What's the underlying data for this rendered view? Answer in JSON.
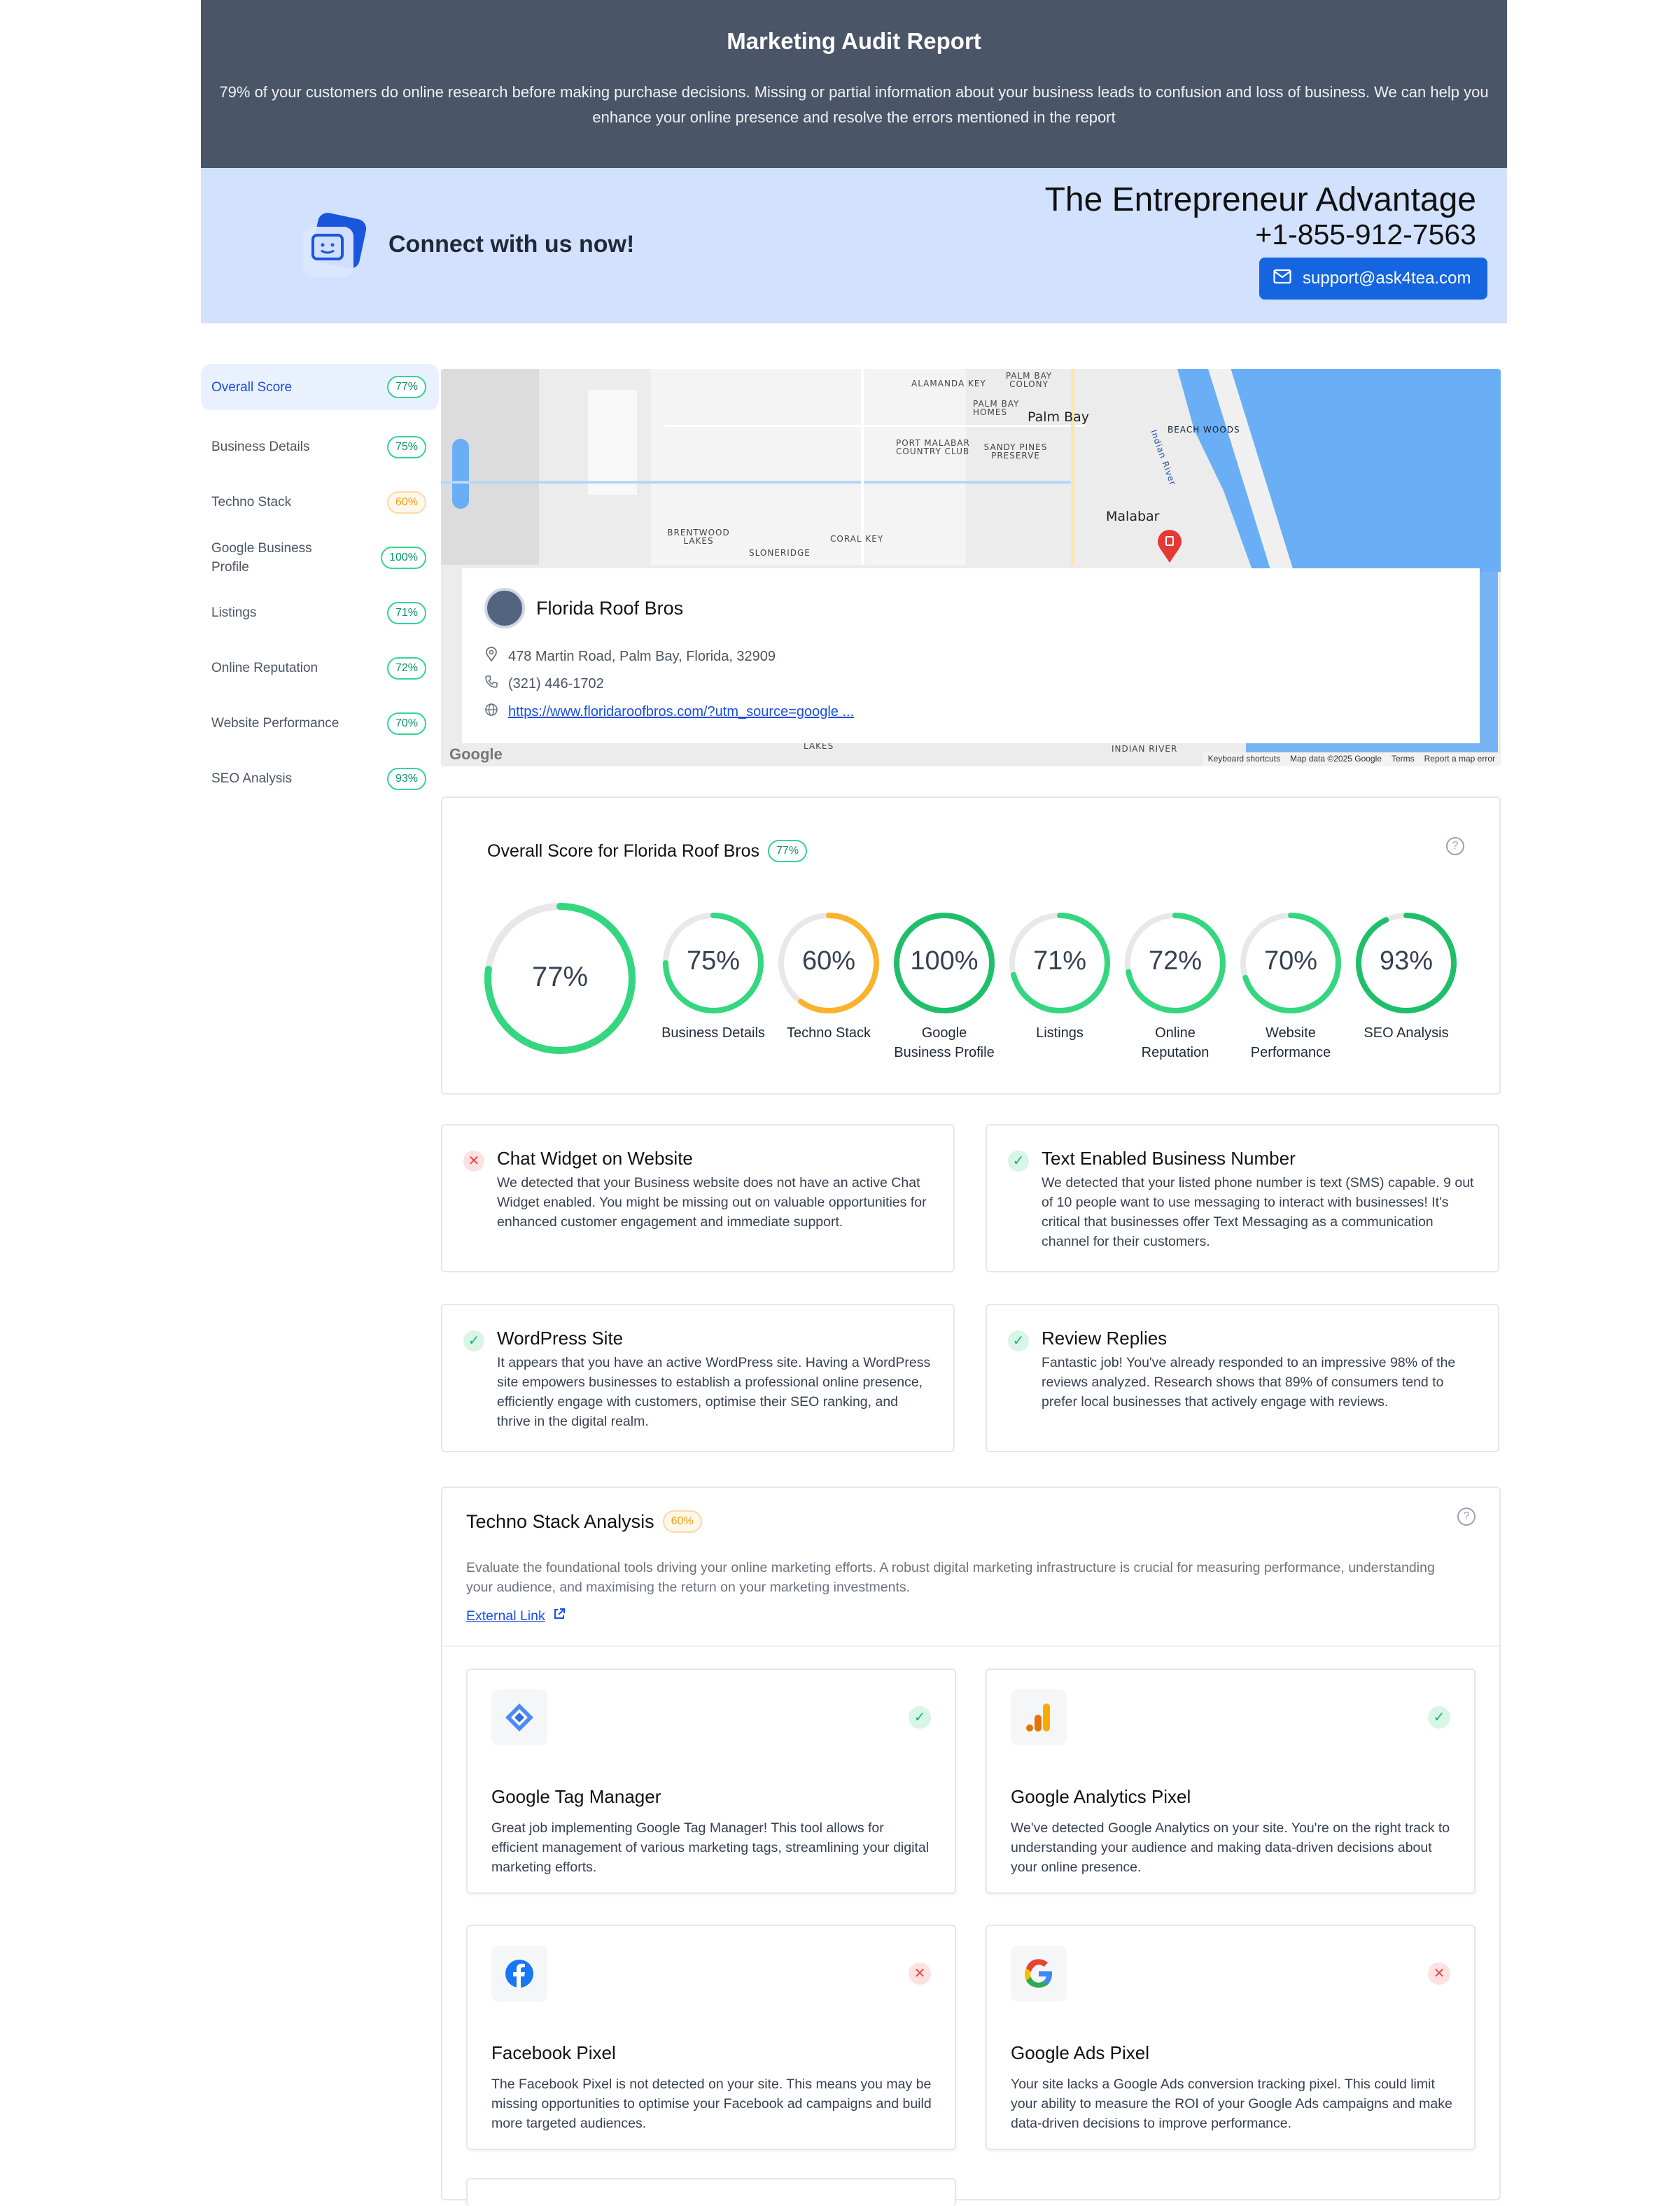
{
  "header": {
    "title": "Marketing Audit Report",
    "subtitle": "79% of your customers do online research before making purchase decisions. Missing or partial information about your business leads to confusion and loss of business. We can help you enhance your online presence and resolve the errors mentioned in the report"
  },
  "connect": {
    "cta": "Connect with us now!",
    "company": "The Entrepreneur Advantage",
    "phone": "+1-855-912-7563",
    "email": "support@ask4tea.com"
  },
  "sidebar": {
    "items": [
      {
        "label": "Overall Score",
        "score": "77%",
        "active": true
      },
      {
        "label": "Business Details",
        "score": "75%"
      },
      {
        "label": "Techno Stack",
        "score": "60%"
      },
      {
        "label": "Google Business Profile",
        "score": "100%"
      },
      {
        "label": "Listings",
        "score": "71%"
      },
      {
        "label": "Online Reputation",
        "score": "72%"
      },
      {
        "label": "Website Performance",
        "score": "70%"
      },
      {
        "label": "SEO Analysis",
        "score": "93%"
      }
    ]
  },
  "map": {
    "labels": [
      "ALAMANDA KEY",
      "PALM BAY COLONY",
      "PALM BAY HOMES",
      "Palm Bay",
      "BEACH WOODS",
      "PORT MALABAR COUNTRY CLUB",
      "SANDY PINES PRESERVE",
      "Indian River",
      "Malabar",
      "BRENTWOOD LAKES",
      "CORAL KEY",
      "SLONERIDGE",
      "INDIAN RIVER",
      "LAKES"
    ],
    "footer": [
      "Keyboard shortcuts",
      "Map data ©2025 Google",
      "Terms",
      "Report a map error"
    ],
    "google": "Google",
    "business": {
      "name": "Florida Roof Bros",
      "address": "478 Martin Road, Palm Bay, Florida, 32909",
      "phone": "(321) 446-1702",
      "website": "https://www.floridaroofbros.com/?utm_source=google ..."
    }
  },
  "overall": {
    "title": "Overall Score for Florida Roof Bros",
    "score": "77%",
    "score_value": 77,
    "help": "?",
    "gauges": [
      {
        "label": "Business Details",
        "value": 75,
        "text": "75%",
        "color": "#34d67f"
      },
      {
        "label": "Techno Stack",
        "value": 60,
        "text": "60%",
        "color": "#fbb32d"
      },
      {
        "label": "Google Business Profile",
        "value": 100,
        "text": "100%",
        "color": "#1fbf6a"
      },
      {
        "label": "Listings",
        "value": 71,
        "text": "71%",
        "color": "#34d67f"
      },
      {
        "label": "Online Reputation",
        "value": 72,
        "text": "72%",
        "color": "#34d67f"
      },
      {
        "label": "Website Performance",
        "value": 70,
        "text": "70%",
        "color": "#34d67f"
      },
      {
        "label": "SEO Analysis",
        "value": 93,
        "text": "93%",
        "color": "#1fbf6a"
      }
    ]
  },
  "checks": [
    {
      "title": "Chat Widget on Website",
      "status": "fail",
      "text": "We detected that your Business website does not have an active Chat Widget enabled. You might be missing out on valuable opportunities for enhanced customer engagement and immediate support."
    },
    {
      "title": "Text Enabled Business Number",
      "status": "pass",
      "text": "We detected that your listed phone number is text (SMS) capable. 9 out of 10 people want to use messaging to interact with businesses! It's critical that businesses offer Text Messaging as a communication channel for their customers."
    },
    {
      "title": "WordPress Site",
      "status": "pass",
      "text": "It appears that you have an active WordPress site. Having a WordPress site empowers businesses to establish a professional online presence, efficiently engage with customers, optimise their SEO ranking, and thrive in the digital realm."
    },
    {
      "title": "Review Replies",
      "status": "pass",
      "text": "Fantastic job! You've already responded to an impressive 98% of the reviews analyzed. Research shows that 89% of consumers tend to prefer local businesses that actively engage with reviews."
    }
  ],
  "techno": {
    "title": "Techno Stack Analysis",
    "score": "60%",
    "help": "?",
    "description": "Evaluate the foundational tools driving your online marketing efforts. A robust digital marketing infrastructure is crucial for measuring performance, understanding your audience, and maximising the return on your marketing investments.",
    "link": "External Link",
    "tools": [
      {
        "name": "Google Tag Manager",
        "icon": "google-tag-manager-icon",
        "status": "pass",
        "text": "Great job implementing Google Tag Manager! This tool allows for efficient management of various marketing tags, streamlining your digital marketing efforts."
      },
      {
        "name": "Google Analytics Pixel",
        "icon": "google-analytics-icon",
        "status": "pass",
        "text": "We've detected Google Analytics on your site. You're on the right track to understanding your audience and making data-driven decisions about your online presence."
      },
      {
        "name": "Facebook Pixel",
        "icon": "facebook-icon",
        "status": "fail",
        "text": "The Facebook Pixel is not detected on your site. This means you may be missing opportunities to optimise your Facebook ad campaigns and build more targeted audiences."
      },
      {
        "name": "Google Ads Pixel",
        "icon": "google-icon",
        "status": "fail",
        "text": "Your site lacks a Google Ads conversion tracking pixel. This could limit your ability to measure the ROI of your Google Ads campaigns and make data-driven decisions to improve performance."
      }
    ]
  }
}
